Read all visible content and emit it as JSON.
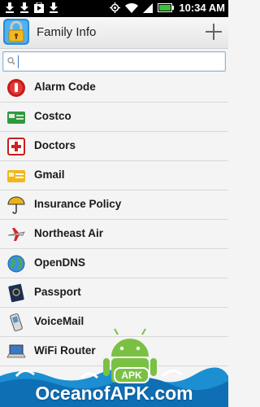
{
  "status_bar": {
    "time": "10:34 AM"
  },
  "app": {
    "title": "Family Info"
  },
  "search": {
    "placeholder": "",
    "value": ""
  },
  "items": [
    {
      "label": "Alarm Code",
      "icon": "alarm-siren-icon"
    },
    {
      "label": "Costco",
      "icon": "membership-card-icon"
    },
    {
      "label": "Doctors",
      "icon": "first-aid-icon"
    },
    {
      "label": "Gmail",
      "icon": "card-icon"
    },
    {
      "label": "Insurance Policy",
      "icon": "umbrella-icon"
    },
    {
      "label": "Northeast Air",
      "icon": "airplane-icon"
    },
    {
      "label": "OpenDNS",
      "icon": "globe-icon"
    },
    {
      "label": "Passport",
      "icon": "passport-icon"
    },
    {
      "label": "VoiceMail",
      "icon": "phone-icon"
    },
    {
      "label": "WiFi Router",
      "icon": "laptop-icon"
    }
  ],
  "watermark": {
    "text": "OceanofAPK.com",
    "badge": "APK"
  },
  "colors": {
    "accent": "#3a7bd5",
    "background": "#f4f4f4"
  }
}
